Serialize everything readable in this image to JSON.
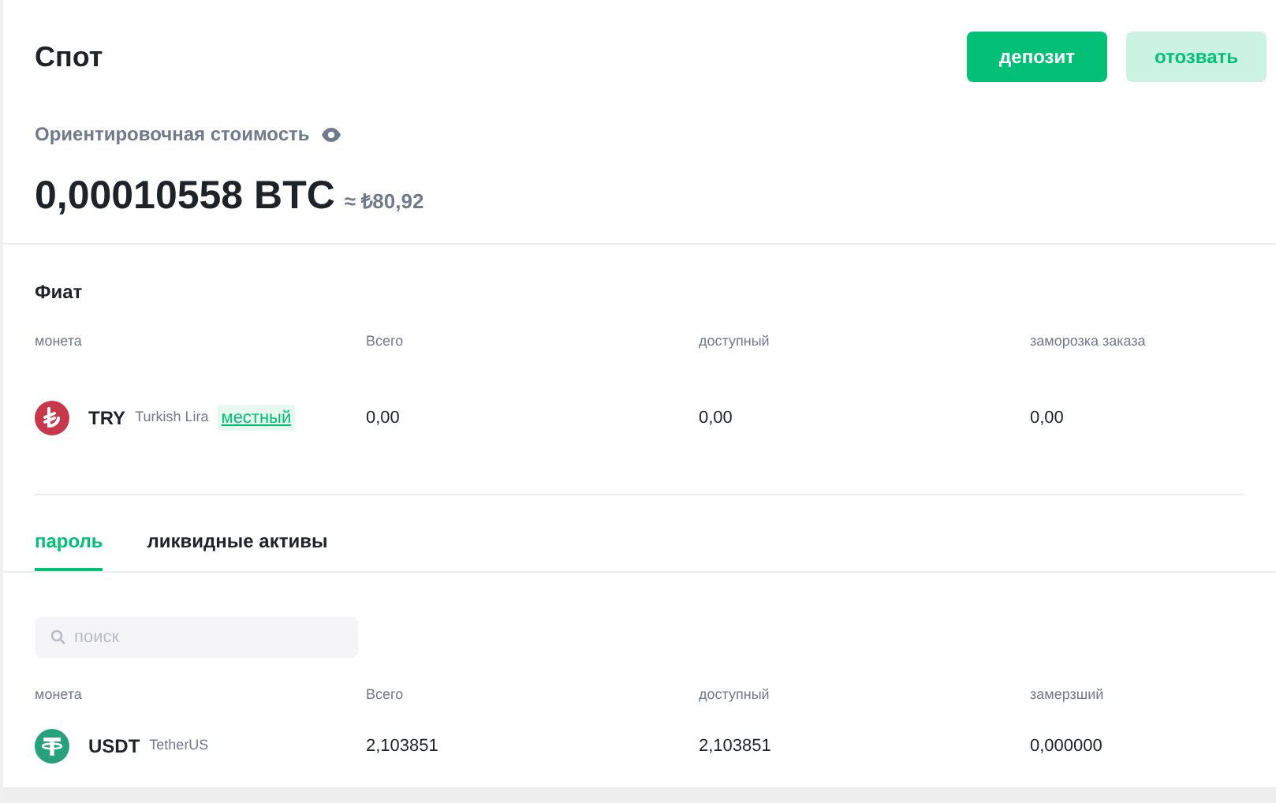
{
  "header": {
    "title": "Спот",
    "buttons": [
      {
        "label": "депозит",
        "kind": "primary"
      },
      {
        "label": "отозвать",
        "kind": "secondary"
      }
    ]
  },
  "estimate": {
    "label": "Ориентировочная стоимость",
    "value": "0,00010558 BTC",
    "approx": "≈ ₺80,92"
  },
  "fiat": {
    "title": "Фиат",
    "columns": [
      "монета",
      "Всего",
      "доступный",
      "заморозка заказа"
    ],
    "rows": [
      {
        "kind": "lira",
        "color": "#c8384b",
        "symbol": "TRY",
        "name": "Turkish Lira",
        "tag": "местный",
        "total": "0,00",
        "available": "0,00",
        "frozen": "0,00"
      }
    ]
  },
  "tabs": [
    {
      "label": "пароль",
      "selected": true
    },
    {
      "label": "ликвидные активы",
      "selected": false
    }
  ],
  "search": {
    "placeholder": "поиск"
  },
  "assets": {
    "columns": [
      "монета",
      "Всего",
      "доступный",
      "замерзший"
    ],
    "rows": [
      {
        "kind": "tether",
        "color": "#26a17b",
        "symbol": "USDT",
        "name": "TetherUS",
        "total": "2,103851",
        "available": "2,103851",
        "frozen": "0,000000"
      }
    ]
  }
}
